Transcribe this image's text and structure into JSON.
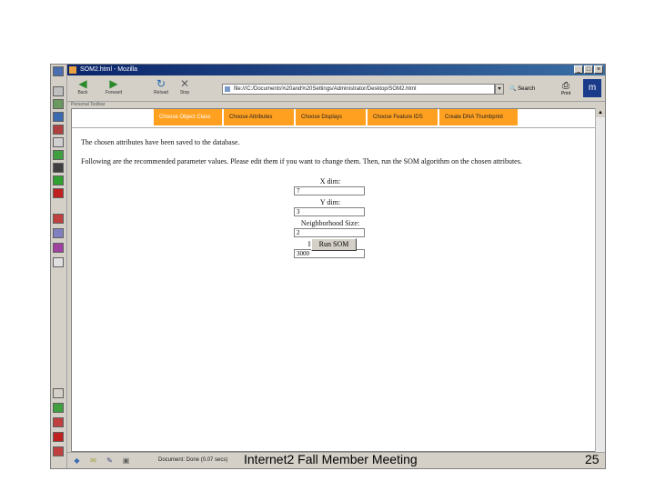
{
  "window": {
    "title": "SOM2.html - Mozilla"
  },
  "toolbar": {
    "back_label": "Back",
    "forward_label": "Forward",
    "reload_label": "Reload",
    "stop_label": "Stop",
    "url": "file:///C:/Documents%20and%20Settings/Administrator/Desktop/SOM2.html",
    "search_label": "Search",
    "print_label": "Print"
  },
  "personal_toolbar": "Personal Toolbar",
  "nav": {
    "tabs": [
      {
        "label": "Choose Object Class"
      },
      {
        "label": "Choose Attributes"
      },
      {
        "label": "Choose Displays"
      },
      {
        "label": "Choose Feature IDS"
      },
      {
        "label": "Create DNA Thumbprint"
      }
    ]
  },
  "main": {
    "message1": "The chosen attributes have been saved to the database.",
    "message2": "Following are the recommended parameter values. Please edit them if you want to change them. Then, run the SOM algorithm on the chosen attributes.",
    "fields": [
      {
        "label": "X dim:",
        "value": "7"
      },
      {
        "label": "Y dim:",
        "value": "3"
      },
      {
        "label": "Neighborhood Size:",
        "value": "2"
      },
      {
        "label": "Iteration times:",
        "value": "3000"
      }
    ],
    "submit_label": "Run SOM"
  },
  "status": {
    "text": "Document: Done (0.07 secs)"
  },
  "slide": {
    "footer": "Internet2 Fall Member Meeting",
    "page_number": "25"
  },
  "colors": {
    "nav_tab": "#ffa020",
    "title_bar": "#0a246a"
  },
  "icons": [
    "back-arrow-icon",
    "forward-arrow-icon",
    "reload-icon",
    "stop-icon",
    "search-icon",
    "print-icon",
    "mozilla-logo"
  ]
}
